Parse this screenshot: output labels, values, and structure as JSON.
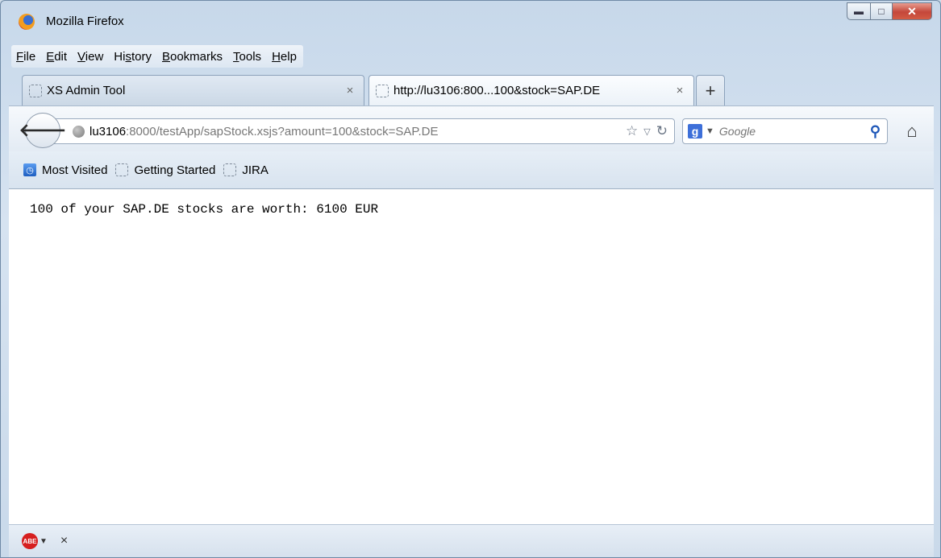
{
  "window": {
    "title": "Mozilla Firefox"
  },
  "menubar": {
    "items": [
      {
        "label": "File"
      },
      {
        "label": "Edit"
      },
      {
        "label": "View"
      },
      {
        "label": "History"
      },
      {
        "label": "Bookmarks"
      },
      {
        "label": "Tools"
      },
      {
        "label": "Help"
      }
    ]
  },
  "tabs": [
    {
      "label": "XS Admin Tool",
      "close": "×",
      "active": false
    },
    {
      "label": "http://lu3106:800...100&stock=SAP.DE",
      "close": "×",
      "active": true
    }
  ],
  "new_tab_label": "+",
  "navbar": {
    "url_host": "lu3106",
    "url_rest": ":8000/testApp/sapStock.xsjs?amount=100&stock=SAP.DE",
    "search_placeholder": "Google"
  },
  "bookmarks": [
    {
      "label": "Most Visited",
      "icon": "most-visited-icon"
    },
    {
      "label": "Getting Started",
      "icon": "blank-favicon"
    },
    {
      "label": "JIRA",
      "icon": "blank-favicon"
    }
  ],
  "content": {
    "text": "100 of your SAP.DE stocks are worth: 6100 EUR"
  },
  "addon_bar": {
    "icon": "abe-icon",
    "close": "×"
  },
  "colors": {
    "chrome": "#cfdcea",
    "close_button": "#c4473a",
    "page_background": "#ffffff"
  }
}
